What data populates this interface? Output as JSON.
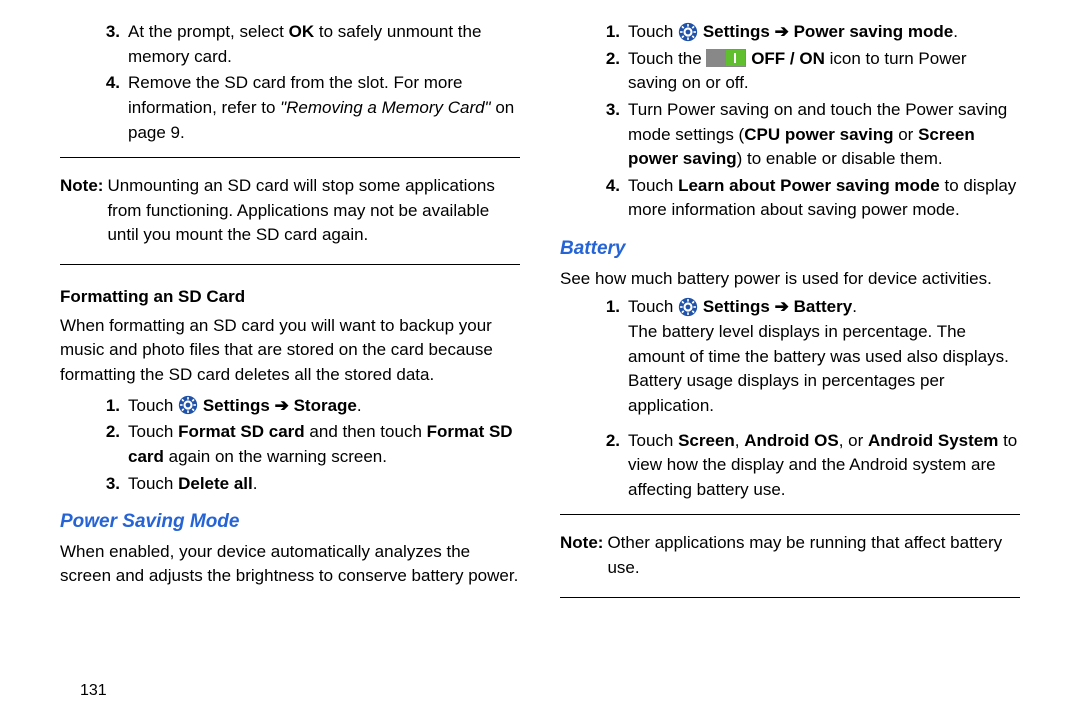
{
  "pageNumber": "131",
  "left": {
    "step3": {
      "n": "3.",
      "pre": "At the prompt, select ",
      "bold": "OK",
      "post": " to safely unmount the memory card."
    },
    "step4": {
      "n": "4.",
      "pre": "Remove the SD card from the slot. For more information, refer to ",
      "ital": "\"Removing a Memory Card\"",
      "post": " on page 9."
    },
    "note1": {
      "label": "Note:",
      "text": "Unmounting an SD card will stop some applications from functioning. Applications may not be available until you mount the SD card again."
    },
    "fmtHeading": "Formatting an SD Card",
    "fmtIntro": "When formatting an SD card you will want to backup your music and photo files that are stored on the card because formatting the SD card deletes all the stored data.",
    "fmt1": {
      "n": "1.",
      "pre": "Touch ",
      "b1": "Settings",
      "arrow": " ➔ ",
      "b2": "Storage",
      "post": "."
    },
    "fmt2": {
      "n": "2.",
      "pre": "Touch ",
      "b1": "Format SD card",
      "mid": " and then touch ",
      "b2": "Format SD card",
      "post": " again on the warning screen."
    },
    "fmt3": {
      "n": "3.",
      "pre": "Touch ",
      "b1": "Delete all",
      "post": "."
    },
    "psmTitle": "Power Saving Mode",
    "psmIntro": "When enabled, your device automatically analyzes the screen and adjusts the brightness to conserve battery power."
  },
  "right": {
    "r1": {
      "n": "1.",
      "pre": "Touch ",
      "b1": "Settings",
      "arrow": " ➔ ",
      "b2": "Power saving mode",
      "post": "."
    },
    "r2": {
      "n": "2.",
      "pre": "Touch the ",
      "b1": "OFF / ON",
      "post": " icon to turn Power saving on or off."
    },
    "r3": {
      "n": "3.",
      "pre": "Turn Power saving on and touch the Power saving mode settings (",
      "b1": "CPU power saving",
      "mid": " or ",
      "b2": "Screen power saving",
      "post": ") to enable or disable them."
    },
    "r4": {
      "n": "4.",
      "pre": "Touch ",
      "b1": "Learn about Power saving mode",
      "post": " to display more information about saving power mode."
    },
    "batTitle": "Battery",
    "batIntro": "See how much battery power is used for device activities.",
    "b1": {
      "n": "1.",
      "pre": "Touch ",
      "bold1": "Settings",
      "arrow": " ➔ ",
      "bold2": "Battery",
      "post": ".",
      "tail": "The battery level displays in percentage. The amount of time the battery was used also displays. Battery usage displays in percentages per application."
    },
    "b2": {
      "n": "2.",
      "pre": "Touch ",
      "bold1": "Screen",
      "c1": ", ",
      "bold2": "Android OS",
      "c2": ", or ",
      "bold3": "Android System",
      "post": "   to view how the display and the Android system are affecting battery use."
    },
    "note2": {
      "label": "Note:",
      "text": "Other applications may be running that affect battery use."
    }
  }
}
